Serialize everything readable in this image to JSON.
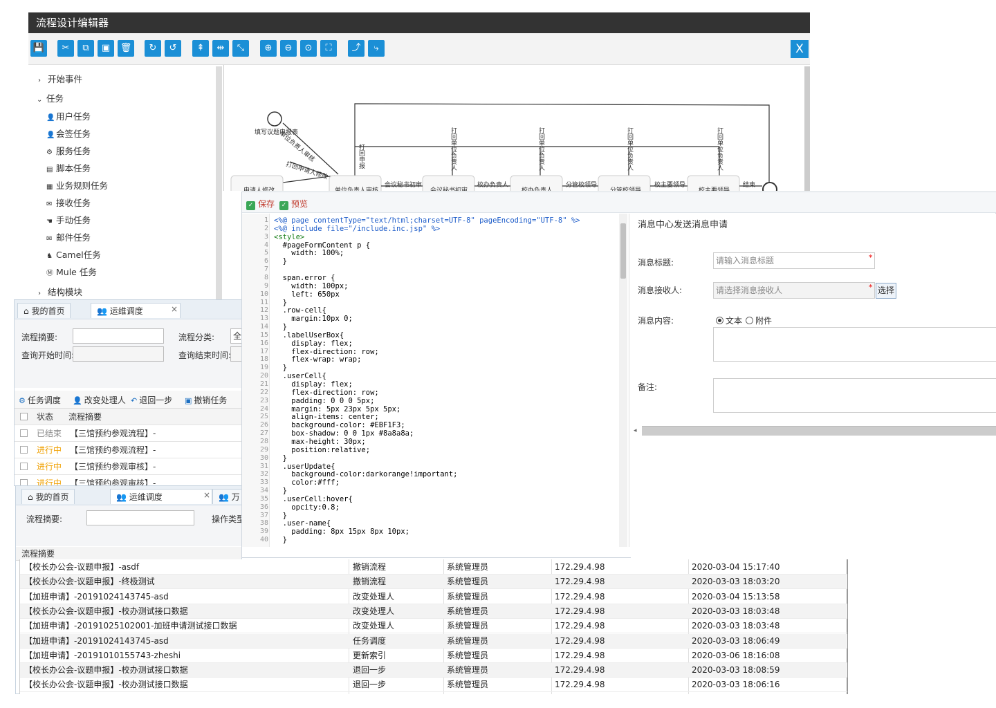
{
  "editor": {
    "title": "流程设计编辑器",
    "close_label": "X",
    "toolbar_icons": [
      "save-icon",
      "cut-icon",
      "copy-icon",
      "paste-icon",
      "delete-icon",
      "redo-icon",
      "undo-icon",
      "align-top-icon",
      "align-middle-icon",
      "align-icon",
      "zoom-in-icon",
      "zoom-out-icon",
      "zoom-actual-icon",
      "fit-icon",
      "connector-icon",
      "connector-alt-icon"
    ],
    "palette": {
      "groups": [
        {
          "label": "开始事件",
          "expanded": false
        },
        {
          "label": "任务",
          "expanded": true
        },
        {
          "label": "结构模块",
          "expanded": false
        }
      ],
      "task_items": [
        "用户任务",
        "会签任务",
        "服务任务",
        "脚本任务",
        "业务规则任务",
        "接收任务",
        "手动任务",
        "邮件任务",
        "Camel任务",
        "Mule 任务"
      ]
    },
    "canvas": {
      "labels": {
        "start": "填写议题申报表",
        "edge1": "单位负责人审核",
        "edge2": "打回申请人修改",
        "apply": "申请人修改",
        "dept": "单位负责人审核",
        "secretary_edge": "会议秘书初审",
        "secretary": "会议秘书初审",
        "principal_edge": "校办负责人",
        "principal": "校办负责人",
        "vp_edge": "分管校领导",
        "vp": "分管校领导",
        "chief_edge": "校主要领导",
        "chief": "校主要领导",
        "end": "结束",
        "back1": "打回申报",
        "back2": "打回单位负责人",
        "back3": "打回单位负责人",
        "back4": "打回单位负责人",
        "back5": "打回单位负责人"
      }
    }
  },
  "designer": {
    "save_label": "保存",
    "preview_label": "预览",
    "code_lines": [
      "<%@ page contentType=\"text/html;charset=UTF-8\" pageEncoding=\"UTF-8\" %>",
      "<%@ include file=\"/include.inc.jsp\" %>",
      "<style>",
      "  #pageFormContent p {",
      "    width: 100%;",
      "  }",
      "",
      "  span.error {",
      "    width: 100px;",
      "    left: 650px",
      "  }",
      "  .row-cell{",
      "    margin:10px 0;",
      "  }",
      "  .labelUserBox{",
      "    display: flex;",
      "    flex-direction: row;",
      "    flex-wrap: wrap;",
      "  }",
      "  .userCell{",
      "    display: flex;",
      "    flex-direction: row;",
      "    padding: 0 0 0 5px;",
      "    margin: 5px 23px 5px 5px;",
      "    align-items: center;",
      "    background-color: #EBF1F3;",
      "    box-shadow: 0 0 1px #8a8a8a;",
      "    max-height: 30px;",
      "    position:relative;",
      "  }",
      "  .userUpdate{",
      "    background-color:darkorange!important;",
      "    color:#fff;",
      "  }",
      "  .userCell:hover{",
      "    opcity:0.8;",
      "  }",
      "  .user-name{",
      "    padding: 8px 15px 8px 10px;",
      "  }"
    ],
    "preview": {
      "title": "消息中心发送消息申请",
      "title_label": "消息标题:",
      "title_placeholder": "请输入消息标题",
      "receiver_label": "消息接收人:",
      "receiver_placeholder": "请选择消息接收人",
      "select_label": "选择",
      "content_label": "消息内容:",
      "radio_text": "文本",
      "radio_attach": "附件",
      "remark_label": "备注:"
    }
  },
  "ops1": {
    "tab_home": "我的首页",
    "tab_ops": "运维调度",
    "label_summary": "流程摘要:",
    "label_category": "流程分类:",
    "category_value": "全",
    "label_start": "查询开始时间:",
    "label_end": "查询结束时间:",
    "tools": [
      "任务调度",
      "改变处理人",
      "退回一步",
      "撤销任务"
    ],
    "col_status": "状态",
    "col_summary": "流程摘要",
    "rows": [
      {
        "status": "已结束",
        "summary": "【三馆预约参观流程】-"
      },
      {
        "status": "进行中",
        "summary": "【三馆预约参观流程】-"
      },
      {
        "status": "进行中",
        "summary": "【三馆预约参观审核】-"
      },
      {
        "status": "进行中",
        "summary": "【三馆预约参观审核】-"
      }
    ]
  },
  "ops2": {
    "tab_home": "我的首页",
    "tab_ops": "运维调度",
    "tab_more": "万",
    "label_summary": "流程摘要:",
    "label_optype": "操作类型",
    "col_summary": "流程摘要"
  },
  "log": {
    "rows": [
      [
        "【校长办公会-议题申报】-asdf",
        "撤销流程",
        "系统管理员",
        "172.29.4.98",
        "2020-03-04 15:17:40"
      ],
      [
        "【校长办公会-议题申报】-终极测试",
        "撤销流程",
        "系统管理员",
        "172.29.4.98",
        "2020-03-03 18:03:20"
      ],
      [
        "【加班申请】-20191024143745-asd",
        "改变处理人",
        "系统管理员",
        "172.29.4.98",
        "2020-03-04 15:13:58"
      ],
      [
        "【校长办公会-议题申报】-校办测试接口数据",
        "改变处理人",
        "系统管理员",
        "172.29.4.98",
        "2020-03-03 18:03:48"
      ],
      [
        "【加班申请】-20191025102001-加班申请测试接口数据",
        "改变处理人",
        "系统管理员",
        "172.29.4.98",
        "2020-03-03 18:03:48"
      ],
      [
        "【加班申请】-20191024143745-asd",
        "任务调度",
        "系统管理员",
        "172.29.4.98",
        "2020-03-03 18:06:49"
      ],
      [
        "【加班申请】-20191010155743-zheshi",
        "更新索引",
        "系统管理员",
        "172.29.4.98",
        "2020-03-06 18:16:08"
      ],
      [
        "【校长办公会-议题申报】-校办测试接口数据",
        "退回一步",
        "系统管理员",
        "172.29.4.98",
        "2020-03-03 18:08:59"
      ],
      [
        "【校长办公会-议题申报】-校办测试接口数据",
        "退回一步",
        "系统管理员",
        "172.29.4.98",
        "2020-03-03 18:06:16"
      ]
    ]
  },
  "colors": {
    "accent": "#1b8fd6",
    "title_bar": "#333333",
    "running": "#f0a000",
    "finished": "#888888"
  }
}
